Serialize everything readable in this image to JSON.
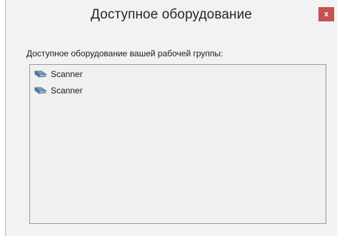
{
  "dialog": {
    "title": "Доступное оборудование",
    "close_label": "x",
    "prompt": "Доступное оборудование вашей рабочей группы:"
  },
  "devices": [
    {
      "label": "Scanner",
      "icon": "scanner-icon"
    },
    {
      "label": "Scanner",
      "icon": "scanner-icon"
    }
  ],
  "colors": {
    "close_button": "#c75050",
    "window_background": "#f2f2f2",
    "list_background": "#f0f0f0"
  }
}
